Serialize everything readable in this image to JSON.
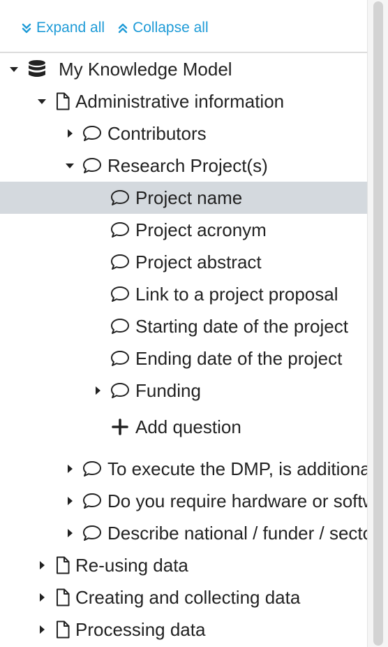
{
  "toolbar": {
    "expand_all": "Expand all",
    "collapse_all": "Collapse all",
    "accent": "#1e9bd7"
  },
  "tree": {
    "root": {
      "label": "My Knowledge Model",
      "icon": "database-icon",
      "expanded": true
    },
    "chapter_admin": {
      "label": "Administrative information",
      "icon": "file-icon",
      "expanded": true
    },
    "q_contributors": {
      "label": "Contributors",
      "icon": "comment-icon",
      "expanded": false
    },
    "q_research_projects": {
      "label": "Research Project(s)",
      "icon": "comment-icon",
      "expanded": true
    },
    "q_project_name": {
      "label": "Project name",
      "icon": "comment-icon",
      "selected": true
    },
    "q_project_acronym": {
      "label": "Project acronym",
      "icon": "comment-icon"
    },
    "q_project_abstract": {
      "label": "Project abstract",
      "icon": "comment-icon"
    },
    "q_project_proposal": {
      "label": "Link to a project proposal",
      "icon": "comment-icon"
    },
    "q_starting_date": {
      "label": "Starting date of the project",
      "icon": "comment-icon"
    },
    "q_ending_date": {
      "label": "Ending date of the project",
      "icon": "comment-icon"
    },
    "q_funding": {
      "label": "Funding",
      "icon": "comment-icon",
      "expanded": false
    },
    "add_question": {
      "label": "Add question",
      "icon": "plus-icon"
    },
    "q_execute_dmp": {
      "label": "To execute the DMP, is additional",
      "icon": "comment-icon",
      "expanded": false
    },
    "q_hardware": {
      "label": "Do you require hardware or software",
      "icon": "comment-icon",
      "expanded": false
    },
    "q_describe_national": {
      "label": "Describe national / funder / sector",
      "icon": "comment-icon",
      "expanded": false
    },
    "chapter_reusing": {
      "label": "Re-using data",
      "icon": "file-icon",
      "expanded": false
    },
    "chapter_creating": {
      "label": "Creating and collecting data",
      "icon": "file-icon",
      "expanded": false
    },
    "chapter_processing": {
      "label": "Processing data",
      "icon": "file-icon",
      "expanded": false
    }
  },
  "colors": {
    "selected_row": "#d4d9de",
    "text": "#222222"
  }
}
